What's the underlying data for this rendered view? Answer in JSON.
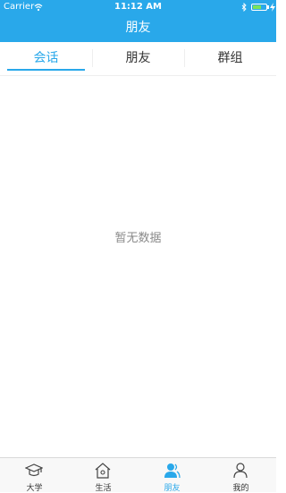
{
  "status_bar": {
    "carrier": "Carrier",
    "time": "11:12 AM"
  },
  "nav": {
    "title": "朋友"
  },
  "tabs": [
    {
      "label": "会话",
      "active": true
    },
    {
      "label": "朋友",
      "active": false
    },
    {
      "label": "群组",
      "active": false
    }
  ],
  "empty_state": {
    "message": "暂无数据"
  },
  "tab_bar": [
    {
      "label": "大学",
      "icon": "graduation-cap-icon",
      "active": false
    },
    {
      "label": "生活",
      "icon": "home-icon",
      "active": false
    },
    {
      "label": "朋友",
      "icon": "friends-icon",
      "active": true
    },
    {
      "label": "我的",
      "icon": "person-icon",
      "active": false
    }
  ],
  "colors": {
    "accent": "#29a8ea",
    "battery": "#7be35a"
  }
}
